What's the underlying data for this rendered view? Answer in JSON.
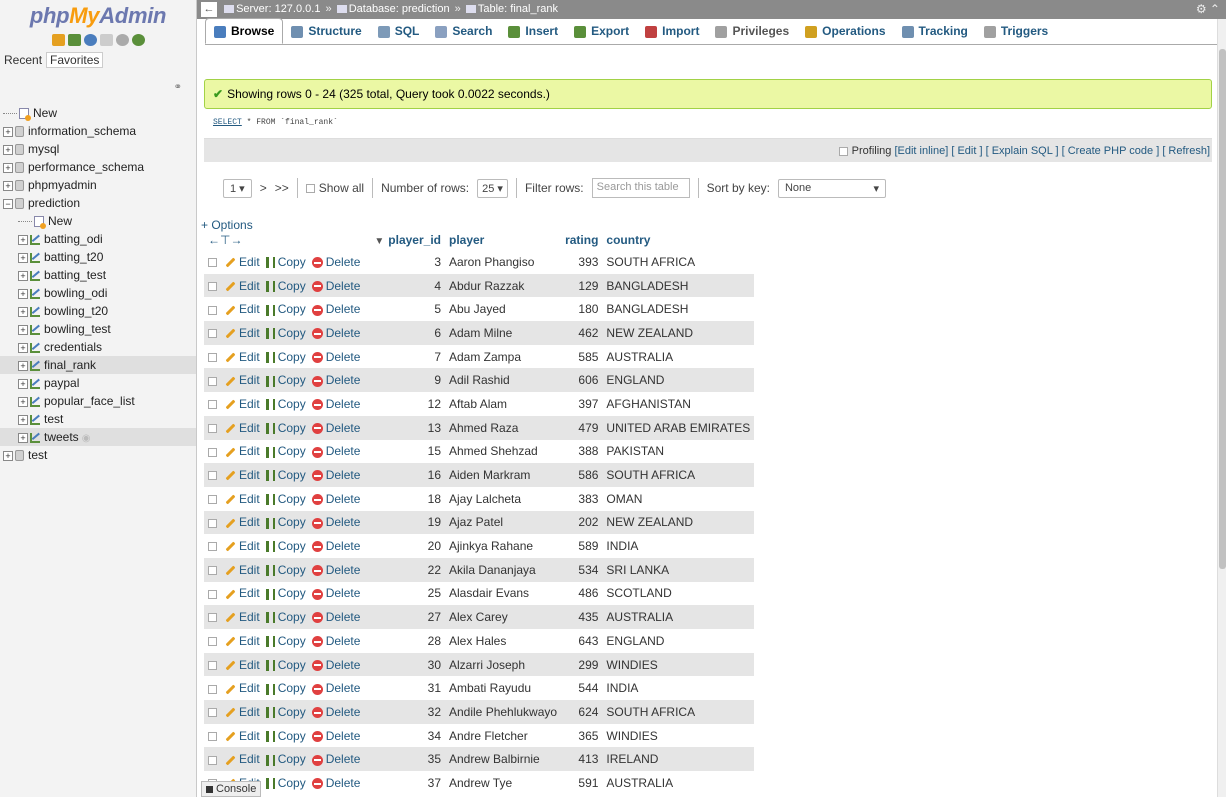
{
  "logo": {
    "php": "php",
    "my": "My",
    "admin": "Admin"
  },
  "nav": {
    "recent": "Recent",
    "favorites": "Favorites",
    "tree": [
      {
        "label": "New",
        "kind": "new",
        "level": 0
      },
      {
        "label": "information_schema",
        "kind": "db",
        "level": 0
      },
      {
        "label": "mysql",
        "kind": "db",
        "level": 0
      },
      {
        "label": "performance_schema",
        "kind": "db",
        "level": 0
      },
      {
        "label": "phpmyadmin",
        "kind": "db",
        "level": 0
      },
      {
        "label": "prediction",
        "kind": "db-open",
        "level": 0
      },
      {
        "label": "New",
        "kind": "new",
        "level": 1
      },
      {
        "label": "batting_odi",
        "kind": "table",
        "level": 1
      },
      {
        "label": "batting_t20",
        "kind": "table",
        "level": 1
      },
      {
        "label": "batting_test",
        "kind": "table",
        "level": 1
      },
      {
        "label": "bowling_odi",
        "kind": "table",
        "level": 1
      },
      {
        "label": "bowling_t20",
        "kind": "table",
        "level": 1
      },
      {
        "label": "bowling_test",
        "kind": "table",
        "level": 1
      },
      {
        "label": "credentials",
        "kind": "table",
        "level": 1
      },
      {
        "label": "final_rank",
        "kind": "table",
        "level": 1,
        "selected": true
      },
      {
        "label": "paypal",
        "kind": "table",
        "level": 1
      },
      {
        "label": "popular_face_list",
        "kind": "table",
        "level": 1
      },
      {
        "label": "test",
        "kind": "table",
        "level": 1
      },
      {
        "label": "tweets",
        "kind": "table",
        "level": 1,
        "selected": true,
        "eye": true
      },
      {
        "label": "test",
        "kind": "db",
        "level": 0
      }
    ]
  },
  "breadcrumb": {
    "server": "Server: 127.0.0.1",
    "database": "Database: prediction",
    "table": "Table: final_rank"
  },
  "tabs": [
    {
      "label": "Browse",
      "icon": "browse-icon",
      "color": "#4a7dbd",
      "active": true
    },
    {
      "label": "Structure",
      "icon": "structure-icon",
      "color": "#6f8fb0"
    },
    {
      "label": "SQL",
      "icon": "sql-icon",
      "color": "#7d9ab8"
    },
    {
      "label": "Search",
      "icon": "search-icon",
      "color": "#8aa0c0"
    },
    {
      "label": "Insert",
      "icon": "insert-icon",
      "color": "#5a8f3a"
    },
    {
      "label": "Export",
      "icon": "export-icon",
      "color": "#5a8f3a"
    },
    {
      "label": "Import",
      "icon": "import-icon",
      "color": "#c04040"
    },
    {
      "label": "Privileges",
      "icon": "privileges-icon",
      "color": "#a0a0a0",
      "dim": true
    },
    {
      "label": "Operations",
      "icon": "operations-icon",
      "color": "#d0a020"
    },
    {
      "label": "Tracking",
      "icon": "tracking-icon",
      "color": "#6f8fb0"
    },
    {
      "label": "Triggers",
      "icon": "triggers-icon",
      "color": "#a0a0a0"
    }
  ],
  "message": "Showing rows 0 - 24 (325 total, Query took 0.0022 seconds.)",
  "sql": {
    "kw": "SELECT",
    "rest": " * FROM `final_rank`"
  },
  "profiling": {
    "label": "Profiling",
    "edit_inline": "[Edit inline]",
    "edit": "[ Edit ]",
    "explain": "[ Explain SQL ]",
    "create_php": "[ Create PHP code ]",
    "refresh": "[ Refresh]"
  },
  "navigation": {
    "page": "1",
    "next": ">",
    "last": ">>",
    "show_all": "Show all",
    "num_rows_label": "Number of rows:",
    "num_rows_value": "25",
    "filter_label": "Filter rows:",
    "filter_placeholder": "Search this table",
    "sort_label": "Sort by key:",
    "sort_value": "None"
  },
  "options_link": "+ Options",
  "columns": [
    "player_id",
    "player",
    "rating",
    "country"
  ],
  "row_actions": {
    "edit": "Edit",
    "copy": "Copy",
    "delete": "Delete"
  },
  "rows": [
    {
      "id": "3",
      "player": "Aaron Phangiso",
      "rating": "393",
      "country": "SOUTH AFRICA"
    },
    {
      "id": "4",
      "player": "Abdur Razzak",
      "rating": "129",
      "country": "BANGLADESH"
    },
    {
      "id": "5",
      "player": "Abu Jayed",
      "rating": "180",
      "country": "BANGLADESH"
    },
    {
      "id": "6",
      "player": "Adam Milne",
      "rating": "462",
      "country": "NEW ZEALAND"
    },
    {
      "id": "7",
      "player": "Adam Zampa",
      "rating": "585",
      "country": "AUSTRALIA"
    },
    {
      "id": "9",
      "player": "Adil Rashid",
      "rating": "606",
      "country": "ENGLAND"
    },
    {
      "id": "12",
      "player": "Aftab Alam",
      "rating": "397",
      "country": "AFGHANISTAN"
    },
    {
      "id": "13",
      "player": "Ahmed Raza",
      "rating": "479",
      "country": "UNITED ARAB EMIRATES"
    },
    {
      "id": "15",
      "player": "Ahmed Shehzad",
      "rating": "388",
      "country": "PAKISTAN"
    },
    {
      "id": "16",
      "player": "Aiden Markram",
      "rating": "586",
      "country": "SOUTH AFRICA"
    },
    {
      "id": "18",
      "player": "Ajay Lalcheta",
      "rating": "383",
      "country": "OMAN"
    },
    {
      "id": "19",
      "player": "Ajaz Patel",
      "rating": "202",
      "country": "NEW ZEALAND"
    },
    {
      "id": "20",
      "player": "Ajinkya Rahane",
      "rating": "589",
      "country": "INDIA"
    },
    {
      "id": "22",
      "player": "Akila Dananjaya",
      "rating": "534",
      "country": "SRI LANKA"
    },
    {
      "id": "25",
      "player": "Alasdair Evans",
      "rating": "486",
      "country": "SCOTLAND"
    },
    {
      "id": "27",
      "player": "Alex Carey",
      "rating": "435",
      "country": "AUSTRALIA"
    },
    {
      "id": "28",
      "player": "Alex Hales",
      "rating": "643",
      "country": "ENGLAND"
    },
    {
      "id": "30",
      "player": "Alzarri Joseph",
      "rating": "299",
      "country": "WINDIES"
    },
    {
      "id": "31",
      "player": "Ambati Rayudu",
      "rating": "544",
      "country": "INDIA"
    },
    {
      "id": "32",
      "player": "Andile Phehlukwayo",
      "rating": "624",
      "country": "SOUTH AFRICA"
    },
    {
      "id": "34",
      "player": "Andre Fletcher",
      "rating": "365",
      "country": "WINDIES"
    },
    {
      "id": "35",
      "player": "Andrew Balbirnie",
      "rating": "413",
      "country": "IRELAND"
    },
    {
      "id": "37",
      "player": "Andrew Tye",
      "rating": "591",
      "country": "AUSTRALIA"
    }
  ],
  "console_label": "Console"
}
